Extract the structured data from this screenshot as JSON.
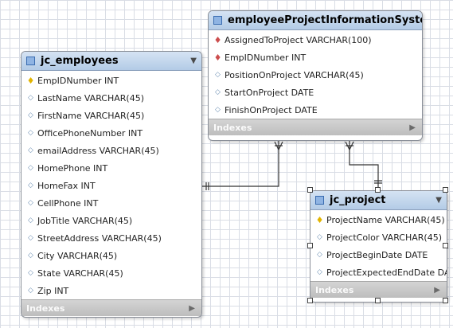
{
  "tables": {
    "employees": {
      "name": "jc_employees",
      "fields": [
        {
          "icon": "key",
          "label": "EmpIDNumber INT"
        },
        {
          "icon": "column",
          "label": "LastName VARCHAR(45)"
        },
        {
          "icon": "column",
          "label": "FirstName VARCHAR(45)"
        },
        {
          "icon": "column",
          "label": "OfficePhoneNumber INT"
        },
        {
          "icon": "column",
          "label": "emailAddress VARCHAR(45)"
        },
        {
          "icon": "column",
          "label": "HomePhone INT"
        },
        {
          "icon": "column",
          "label": "HomeFax INT"
        },
        {
          "icon": "column",
          "label": "CellPhone INT"
        },
        {
          "icon": "column",
          "label": "JobTitle VARCHAR(45)"
        },
        {
          "icon": "column",
          "label": "StreetAddress VARCHAR(45)"
        },
        {
          "icon": "column",
          "label": "City VARCHAR(45)"
        },
        {
          "icon": "column",
          "label": "State VARCHAR(45)"
        },
        {
          "icon": "column",
          "label": "Zip INT"
        }
      ],
      "indexes_label": "Indexes"
    },
    "eprojinfo": {
      "name": "employeeProjectInformationSystem",
      "fields": [
        {
          "icon": "foreign-key",
          "label": "AssignedToProject VARCHAR(100)"
        },
        {
          "icon": "foreign-key",
          "label": "EmpIDNumber INT"
        },
        {
          "icon": "column",
          "label": "PositionOnProject VARCHAR(45)"
        },
        {
          "icon": "column",
          "label": "StartOnProject DATE"
        },
        {
          "icon": "column",
          "label": "FinishOnProject DATE"
        }
      ],
      "indexes_label": "Indexes"
    },
    "project": {
      "name": "jc_project",
      "fields": [
        {
          "icon": "key",
          "label": "ProjectName VARCHAR(45)"
        },
        {
          "icon": "column",
          "label": "ProjectColor VARCHAR(45)"
        },
        {
          "icon": "column",
          "label": "ProjectBeginDate DATE"
        },
        {
          "icon": "column",
          "label": "ProjectExpectedEndDate DATE"
        }
      ],
      "indexes_label": "Indexes"
    }
  },
  "relationships": [
    {
      "from": "jc_employees",
      "to": "employeeProjectInformationSystem",
      "cardinality": "one-to-many"
    },
    {
      "from": "jc_project",
      "to": "employeeProjectInformationSystem",
      "cardinality": "one-to-many"
    }
  ],
  "selected_table": "jc_project",
  "colors": {
    "header": "#b3cbe6",
    "indexes_bar": "#c8c8c8",
    "key": "#e2b400",
    "foreign_key": "#cc4d4d",
    "grid": "#d9dde5"
  }
}
